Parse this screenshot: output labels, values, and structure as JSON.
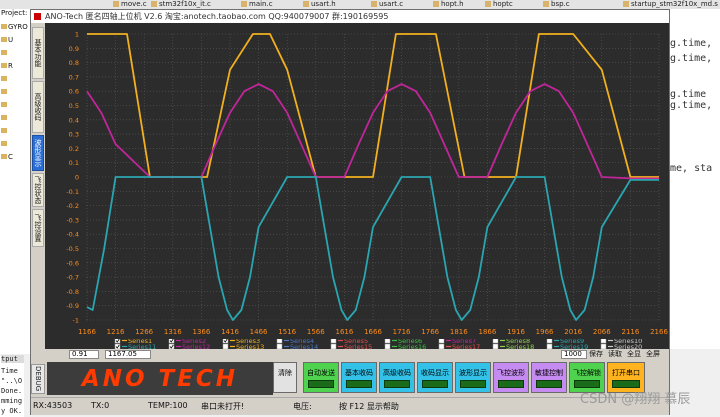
{
  "ide": {
    "tabs": [
      "move.c",
      "stm32f10x_it.c",
      "main.c",
      "usart.h",
      "usart.c",
      "hopt.h",
      "hoptc",
      "bsp.c",
      "startup_stm32f10x_md.s"
    ],
    "project_label": "Project: I",
    "tree_items": [
      "GYRO",
      "U",
      "",
      "R",
      "",
      "",
      "",
      "",
      "",
      "",
      "C"
    ],
    "code_lines": [
      "ng.time,",
      "ng.time,",
      "",
      "ng.time",
      "ng.time,",
      "",
      "ime, sta"
    ],
    "output_title": "tput",
    "output_lines": [
      "Time",
      "\"..\\O",
      "Done.",
      "mming",
      "y OK."
    ]
  },
  "app": {
    "title": "ANO-Tech 匿名四轴上位机  V2.6  淘宝:anotech.taobao.com  QQ:940079007  群:190169595",
    "side_tabs": [
      {
        "label": "基本功能",
        "active": false
      },
      {
        "label": "高级收码",
        "active": false
      },
      {
        "label": "波形显示",
        "active": true
      },
      {
        "label": "飞控状态",
        "active": false
      },
      {
        "label": "飞控设置",
        "active": false
      }
    ],
    "status_strip": {
      "left_value": "0.91",
      "mid_value": "1167.05",
      "count_value": "1000",
      "buttons": [
        "保存",
        "读取",
        "全显",
        "全屏"
      ]
    },
    "logo_text": "ANO TECH",
    "panel_vlabel": "DEBUG",
    "controls": [
      {
        "label": "清除",
        "style": "plain"
      },
      {
        "label": "自动发送",
        "style": "green"
      },
      {
        "label": "基本收码",
        "style": "blue"
      },
      {
        "label": "高级收码",
        "style": "blue"
      },
      {
        "label": "收码显示",
        "style": "blue"
      },
      {
        "label": "波形显示",
        "style": "blue"
      },
      {
        "label": "飞控波形",
        "style": "purple"
      },
      {
        "label": "敏捷控制",
        "style": "purple"
      },
      {
        "label": "飞控解锁",
        "style": "green"
      },
      {
        "label": "打开串口",
        "style": "yellow"
      }
    ],
    "statusbar": {
      "rx": "RX:43503",
      "tx": "TX:0",
      "temp": "TEMP:100",
      "port": "串口未打开!",
      "voltage": "电压:",
      "help": "按 F12 显示帮助",
      "watermark": "CSDN @翔翔 慕辰"
    }
  },
  "colors": {
    "plot_bg": "#2c2c2c",
    "grid": "#5a5a5a",
    "tick_label": "#ff8c1a",
    "series1": "#f2b01e",
    "series2": "#c0269a",
    "series3": "#2aa6b0"
  },
  "chart_data": {
    "type": "line",
    "xlim": [
      1166,
      2166
    ],
    "ylim": [
      -1,
      1
    ],
    "x_ticks": [
      1166,
      1216,
      1266,
      1316,
      1366,
      1416,
      1466,
      1516,
      1566,
      1616,
      1666,
      1716,
      1766,
      1816,
      1866,
      1916,
      1966,
      2016,
      2066,
      2116,
      2166
    ],
    "y_ticks": [
      -1,
      -0.9,
      -0.8,
      -0.7,
      -0.6,
      -0.5,
      -0.4,
      -0.3,
      -0.2,
      -0.1,
      0,
      0.1,
      0.2,
      0.3,
      0.4,
      0.5,
      0.6,
      0.7,
      0.8,
      0.9,
      1
    ],
    "y_tick_labels": [
      "-1",
      "-0.9",
      "-0.8",
      "-0.7",
      "-0.6",
      "-0.5",
      "-0.4",
      "-0.3",
      "-0.2",
      "-0.1",
      "0",
      "0.1",
      "0.2",
      "0.3",
      "0.4",
      "0.5",
      "0.6",
      "0.7",
      "0.8",
      "0.9",
      "1"
    ],
    "grid": true,
    "legend": [
      {
        "name": "Series1",
        "checked": true,
        "color": "#f2b01e"
      },
      {
        "name": "Series2",
        "checked": true,
        "color": "#c0269a"
      },
      {
        "name": "Series3",
        "checked": true,
        "color": "#f2b01e"
      },
      {
        "name": "Series4",
        "checked": false,
        "color": "#4a78c8"
      },
      {
        "name": "Series5",
        "checked": false,
        "color": "#e64c4c"
      },
      {
        "name": "Series6",
        "checked": false,
        "color": "#3fbf3f"
      },
      {
        "name": "Series7",
        "checked": false,
        "color": "#c0269a"
      },
      {
        "name": "Series8",
        "checked": false,
        "color": "#8fd14f"
      },
      {
        "name": "Series9",
        "checked": false,
        "color": "#2aa6b0"
      },
      {
        "name": "Series10",
        "checked": false,
        "color": "#cccccc"
      },
      {
        "name": "Series11",
        "checked": true,
        "color": "#2aa6b0"
      },
      {
        "name": "Series12",
        "checked": true,
        "color": "#c0269a"
      },
      {
        "name": "Series13",
        "checked": false,
        "color": "#f2b01e"
      },
      {
        "name": "Series14",
        "checked": false,
        "color": "#4a78c8"
      },
      {
        "name": "Series15",
        "checked": false,
        "color": "#e64c4c"
      },
      {
        "name": "Series16",
        "checked": false,
        "color": "#3fbf3f"
      },
      {
        "name": "Series17",
        "checked": false,
        "color": "#e64c4c"
      },
      {
        "name": "Series18",
        "checked": false,
        "color": "#8fd14f"
      },
      {
        "name": "Series19",
        "checked": false,
        "color": "#2aa6b0"
      },
      {
        "name": "Series20",
        "checked": false,
        "color": "#cccccc"
      }
    ],
    "series": [
      {
        "name": "Series1",
        "color": "#f2b01e",
        "x": [
          1166,
          1206,
          1236,
          1276,
          1336,
          1376,
          1416,
          1456,
          1486,
          1516,
          1566,
          1616,
          1666,
          1706,
          1736,
          1776,
          1826,
          1866,
          1916,
          1956,
          1986,
          2016,
          2066,
          2116,
          2166
        ],
        "y": [
          1,
          1,
          1,
          0,
          0,
          0,
          0.75,
          1,
          1,
          0.75,
          0,
          0,
          0,
          1,
          1,
          1,
          0,
          0,
          0,
          1,
          1,
          1,
          0.75,
          0,
          0
        ]
      },
      {
        "name": "Series2",
        "color": "#c0269a",
        "x": [
          1166,
          1191,
          1216,
          1276,
          1346,
          1366,
          1391,
          1416,
          1441,
          1466,
          1491,
          1516,
          1566,
          1616,
          1641,
          1666,
          1691,
          1716,
          1741,
          1766,
          1816,
          1866,
          1891,
          1916,
          1941,
          1966,
          1991,
          2016,
          2066,
          2116,
          2166
        ],
        "y": [
          0.6,
          0.45,
          0.23,
          0,
          0,
          0,
          0.23,
          0.45,
          0.6,
          0.65,
          0.6,
          0.45,
          0,
          0,
          0.23,
          0.45,
          0.6,
          0.65,
          0.6,
          0.45,
          0,
          0,
          0.23,
          0.45,
          0.6,
          0.65,
          0.6,
          0.45,
          0,
          -0.01,
          -0.01
        ]
      },
      {
        "name": "Series11",
        "color": "#2aa6b0",
        "x": [
          1166,
          1176,
          1196,
          1216,
          1226,
          1236,
          1276,
          1336,
          1366,
          1381,
          1396,
          1411,
          1421,
          1436,
          1451,
          1466,
          1516,
          1566,
          1581,
          1596,
          1611,
          1621,
          1636,
          1651,
          1666,
          1716,
          1766,
          1781,
          1796,
          1811,
          1821,
          1836,
          1851,
          1866,
          1916,
          1966,
          1981,
          1996,
          2011,
          2021,
          2036,
          2051,
          2066,
          2116,
          2166
        ],
        "y": [
          -0.91,
          -0.93,
          -0.5,
          0,
          0,
          0,
          0,
          0,
          0,
          -0.35,
          -0.7,
          -0.93,
          -1,
          -0.93,
          -0.7,
          -0.35,
          0,
          0,
          -0.35,
          -0.7,
          -0.93,
          -1,
          -0.93,
          -0.7,
          -0.35,
          0,
          0,
          -0.35,
          -0.7,
          -0.93,
          -1,
          -0.93,
          -0.7,
          -0.35,
          0,
          0,
          -0.35,
          -0.7,
          -0.93,
          -1,
          -0.93,
          -0.7,
          -0.35,
          -0.02,
          -0.02
        ]
      }
    ]
  }
}
